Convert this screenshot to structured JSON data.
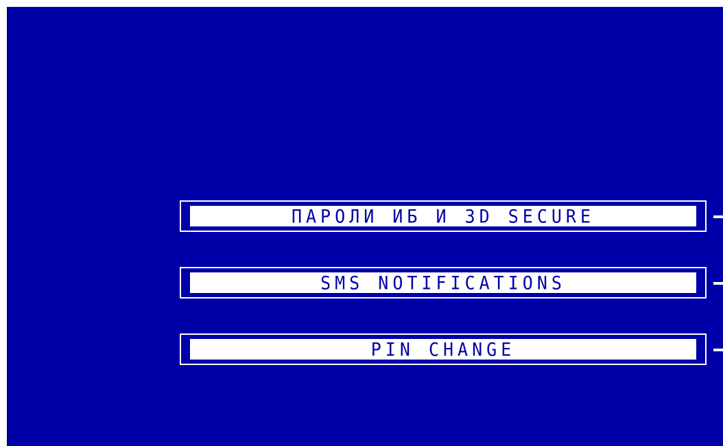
{
  "screen": {
    "background_color": "#0000a8",
    "foreground_color": "#ffffff"
  },
  "menu": {
    "items": [
      {
        "label": "ПАРОЛИ ИБ И 3D SECURE",
        "side_key_icon": "side-key-arrow-icon"
      },
      {
        "label": "SMS NOTIFICATIONS",
        "side_key_icon": "side-key-arrow-icon"
      },
      {
        "label": "PIN CHANGE",
        "side_key_icon": "side-key-arrow-icon"
      }
    ]
  }
}
